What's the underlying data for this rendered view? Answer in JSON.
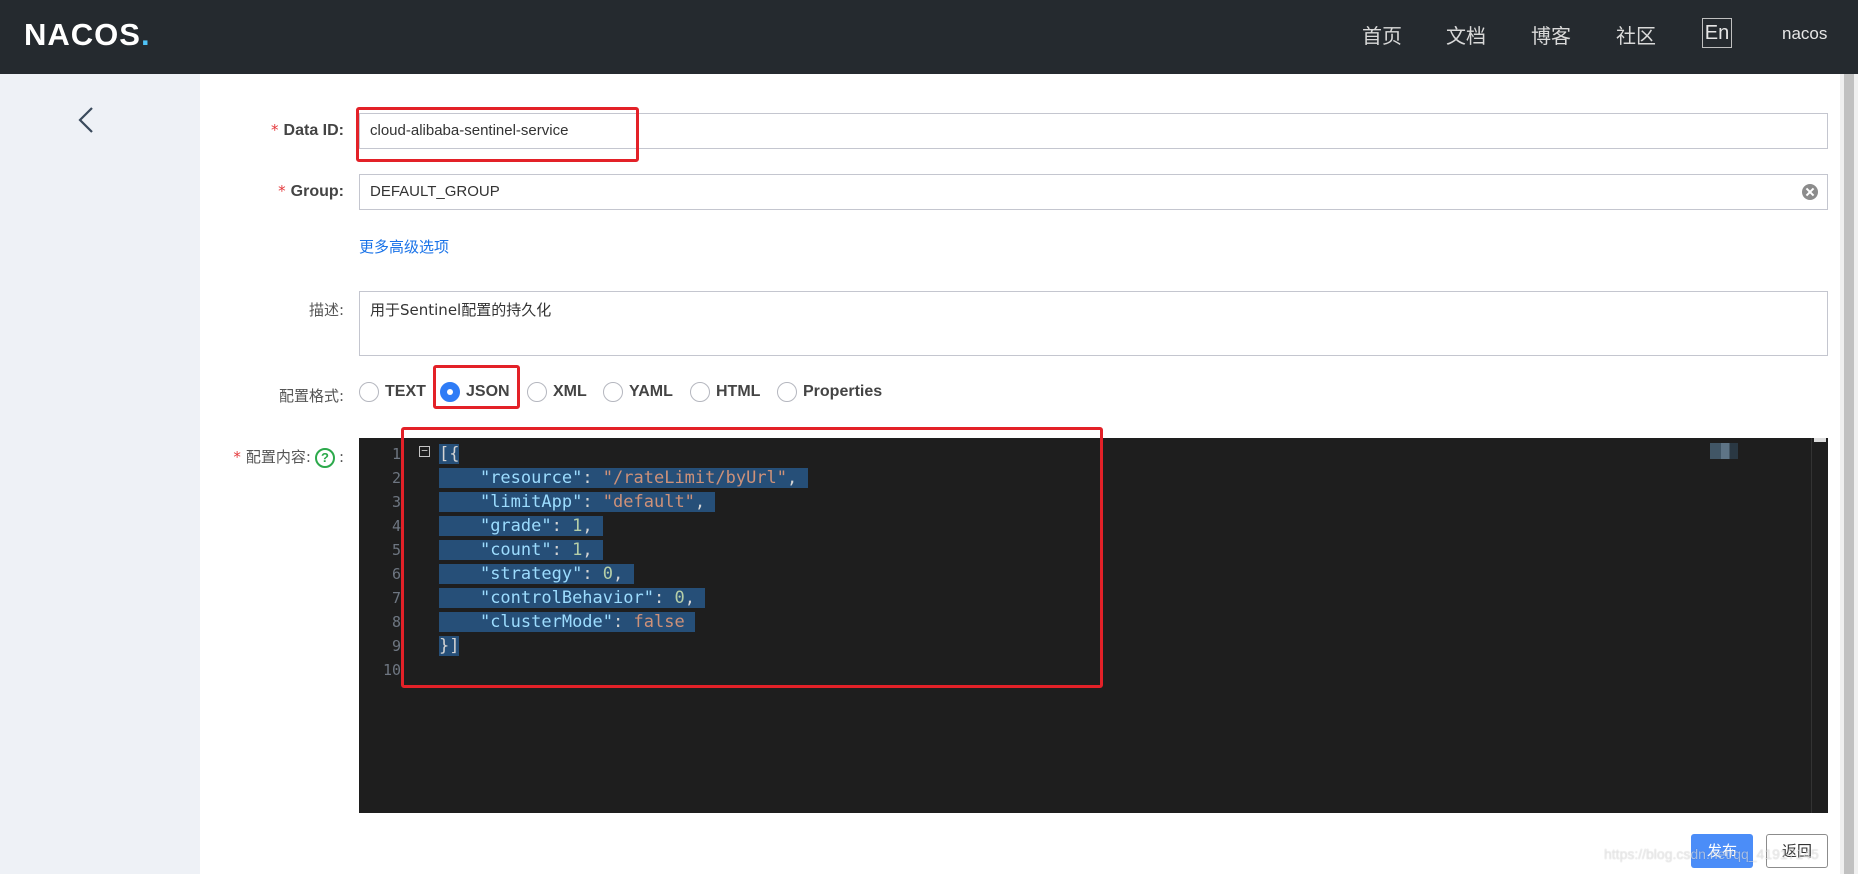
{
  "header": {
    "logo": "NACOS",
    "nav": [
      {
        "key": "home",
        "label": "首页"
      },
      {
        "key": "docs",
        "label": "文档"
      },
      {
        "key": "blog",
        "label": "博客"
      },
      {
        "key": "community",
        "label": "社区"
      }
    ],
    "lang": "En",
    "user": "nacos"
  },
  "form": {
    "data_id": {
      "label": "Data ID:",
      "value": "cloud-alibaba-sentinel-service"
    },
    "group": {
      "label": "Group:",
      "value": "DEFAULT_GROUP"
    },
    "advanced_link": "更多高级选项",
    "description": {
      "label": "描述:",
      "value": "用于Sentinel配置的持久化"
    },
    "format": {
      "label": "配置格式:",
      "options": [
        "TEXT",
        "JSON",
        "XML",
        "YAML",
        "HTML",
        "Properties"
      ],
      "selected": "JSON"
    },
    "content": {
      "label": "配置内容:",
      "suffix": ":",
      "help": "?"
    }
  },
  "editor": {
    "line_numbers": [
      "1",
      "2",
      "3",
      "4",
      "5",
      "6",
      "7",
      "8",
      "9",
      "10"
    ],
    "fold_marker": "−",
    "lines": [
      {
        "text": "[{"
      },
      {
        "key": "\"resource\"",
        "value": "\"/rateLimit/byUrl\"",
        "vtype": "str",
        "trail": ","
      },
      {
        "key": "\"limitApp\"",
        "value": "\"default\"",
        "vtype": "str",
        "trail": ","
      },
      {
        "key": "\"grade\"",
        "value": "1",
        "vtype": "num",
        "trail": ","
      },
      {
        "key": "\"count\"",
        "value": "1",
        "vtype": "num",
        "trail": ","
      },
      {
        "key": "\"strategy\"",
        "value": "0",
        "vtype": "num",
        "trail": ","
      },
      {
        "key": "\"controlBehavior\"",
        "value": "0",
        "vtype": "num",
        "trail": ","
      },
      {
        "key": "\"clusterMode\"",
        "value": "false",
        "vtype": "bool",
        "trail": ""
      },
      {
        "text": "}]"
      }
    ]
  },
  "buttons": {
    "publish": "发布",
    "back": "返回"
  },
  "watermark": "https://blog.csdn.net/qq_41917145",
  "colors": {
    "header_bg": "#252a2f",
    "annotation": "#e32128",
    "primary": "#4b8df8",
    "editor_bg": "#1e1e1e"
  },
  "icons": [
    "back-chevron-icon",
    "clear-icon",
    "help-circle-icon",
    "fold-icon"
  ]
}
